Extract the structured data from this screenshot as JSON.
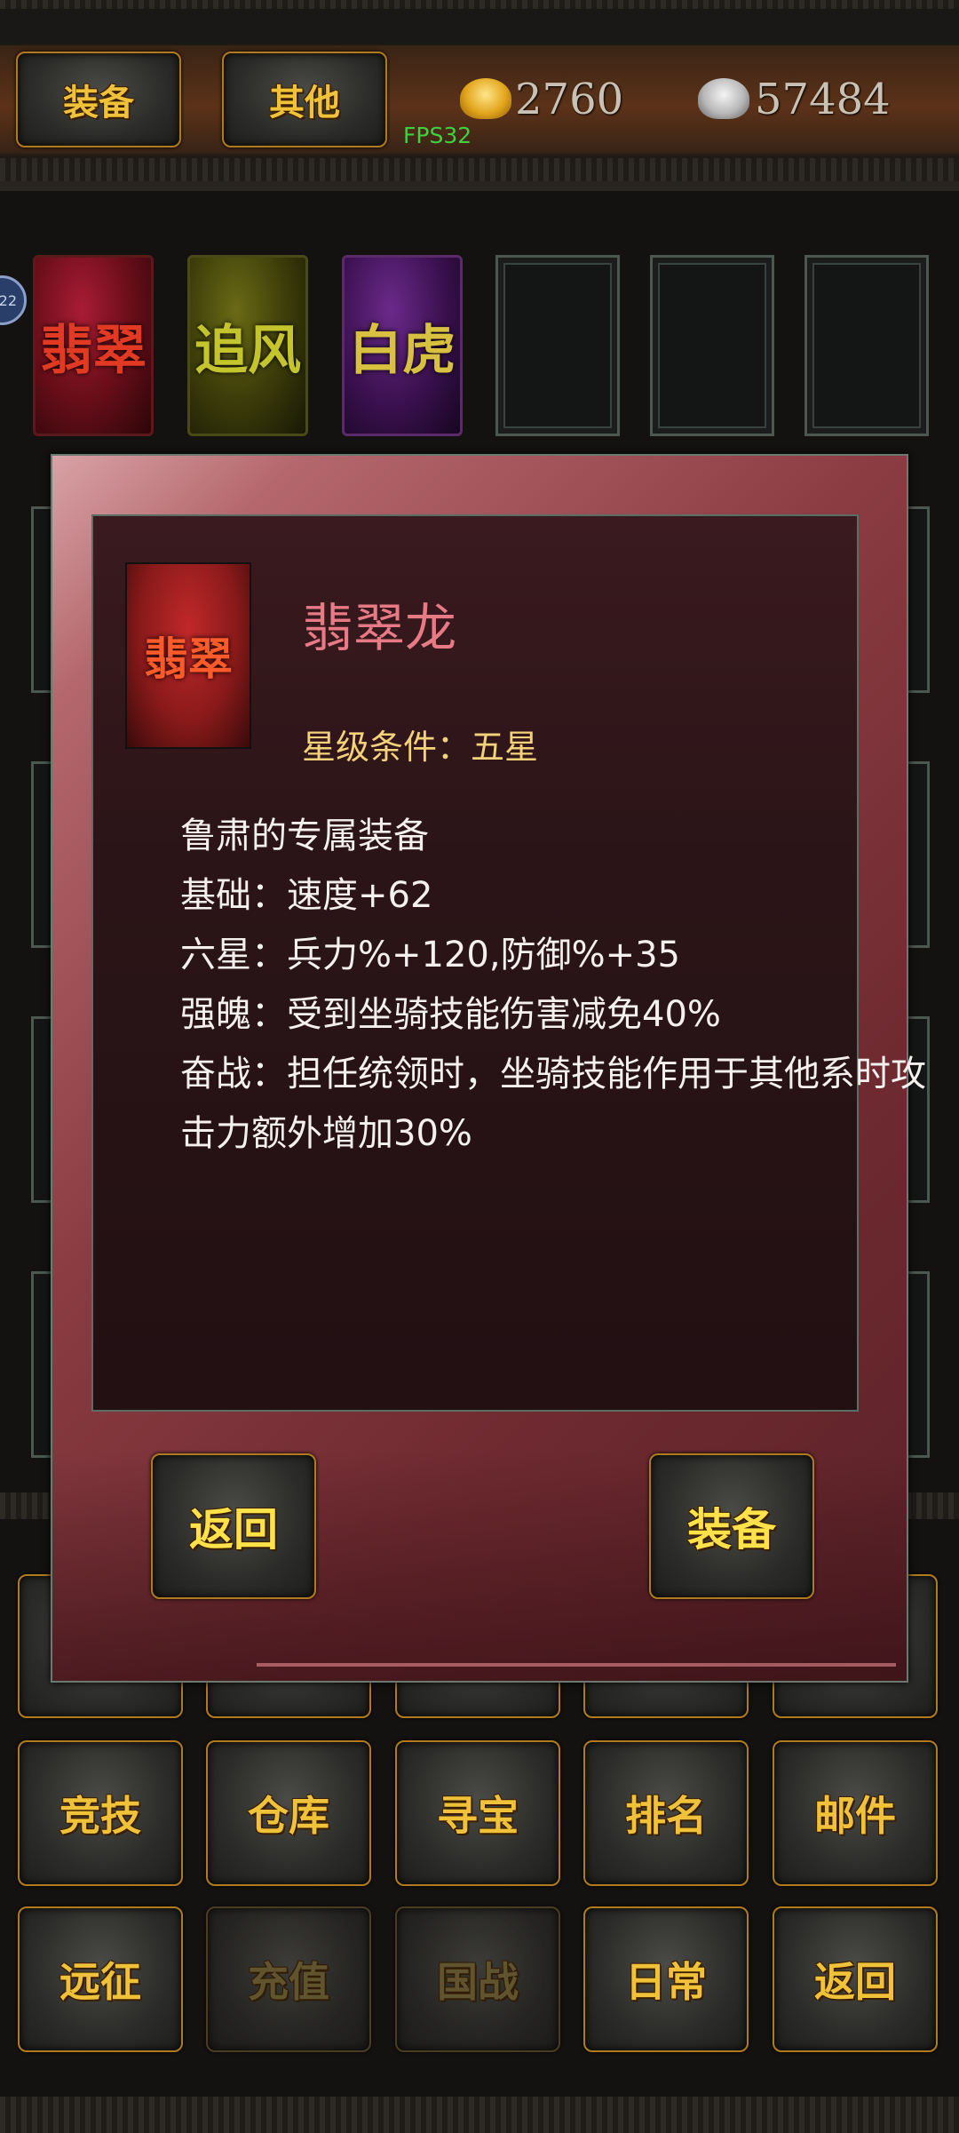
{
  "header": {
    "tabs": [
      {
        "label": "装备"
      },
      {
        "label": "其他"
      }
    ],
    "fps": "FPS32",
    "gold": {
      "icon": "gold-ingot-icon",
      "value": "2760"
    },
    "silver": {
      "icon": "silver-ingot-icon",
      "value": "57484"
    }
  },
  "side_badge": "22",
  "mounts": [
    {
      "label": "翡翠",
      "color": "#d43a26"
    },
    {
      "label": "追风",
      "color": "#b0b02a"
    },
    {
      "label": "白虎",
      "color": "#c8b030"
    }
  ],
  "dialog": {
    "item_name": "翡翠龙",
    "item_icon_label": "翡翠",
    "star_condition": "星级条件：五星",
    "description": [
      "鲁肃的专属装备",
      "基础：速度+62",
      "六星：兵力%+120,防御%+35",
      "强魄：受到坐骑技能伤害减免40%",
      "奋战：担任统领时，坐骑技能作用于其他系时攻",
      "击力额外增加30%"
    ],
    "back_button": "返回",
    "equip_button": "装备"
  },
  "bottom_menu": {
    "row1": [
      {
        "label": "竞技",
        "enabled": true
      },
      {
        "label": "仓库",
        "enabled": true
      },
      {
        "label": "寻宝",
        "enabled": true
      },
      {
        "label": "排名",
        "enabled": true
      },
      {
        "label": "邮件",
        "enabled": true
      }
    ],
    "row2": [
      {
        "label": "远征",
        "enabled": true
      },
      {
        "label": "充值",
        "enabled": false
      },
      {
        "label": "国战",
        "enabled": false
      },
      {
        "label": "日常",
        "enabled": true
      },
      {
        "label": "返回",
        "enabled": true
      }
    ]
  },
  "colors": {
    "accent_gold": "#f0c23a",
    "item_name": "#e87a86",
    "star_condition": "#f3d27a",
    "fps": "#3fd13f"
  }
}
